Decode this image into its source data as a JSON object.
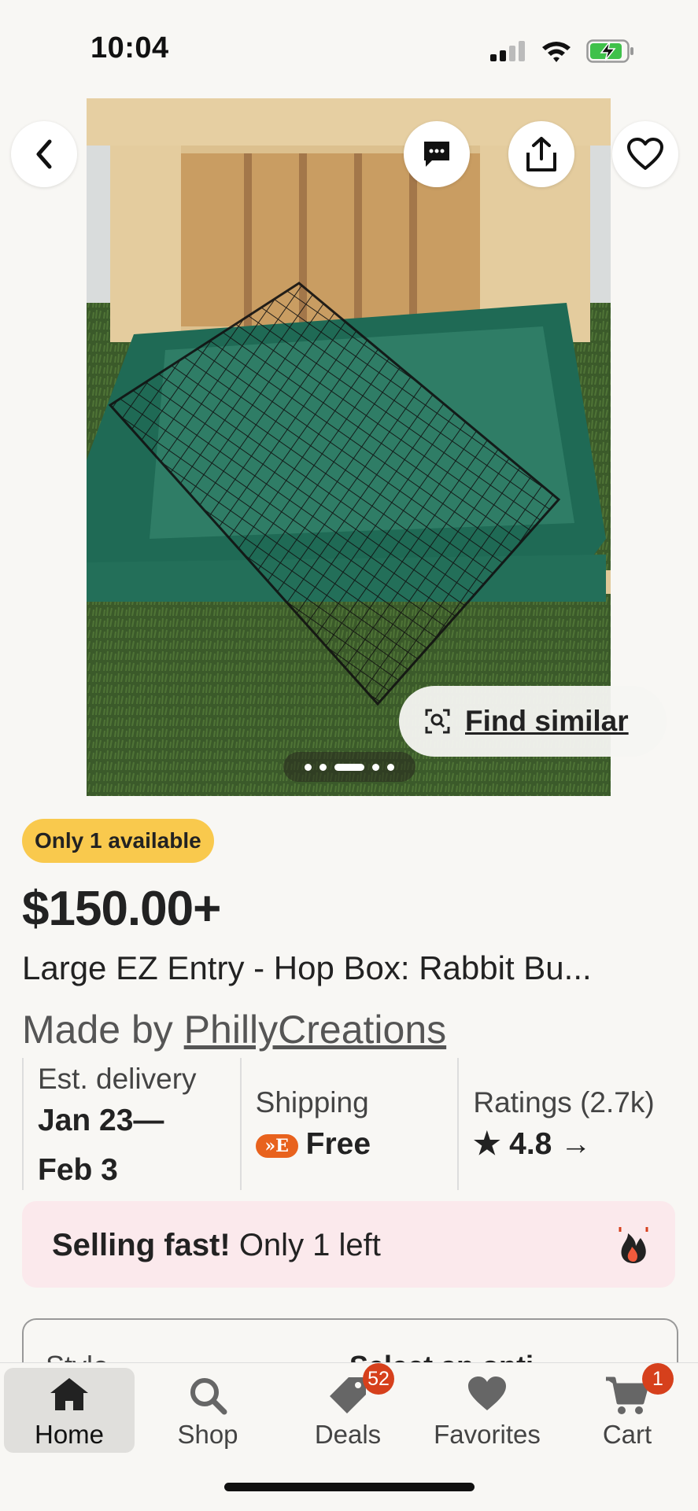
{
  "status_bar": {
    "time": "10:04"
  },
  "hero": {
    "find_similar_label": "Find similar",
    "image_count": 5,
    "active_image": 3
  },
  "listing": {
    "availability_badge": "Only 1 available",
    "price": "$150.00+",
    "title": "Large EZ Entry - Hop Box: Rabbit Bu...",
    "made_by_prefix": "Made by ",
    "shop_name": "PhillyCreations"
  },
  "stats": {
    "delivery_label": "Est. delivery",
    "delivery_line1": "Jan 23—",
    "delivery_line2": "Feb 3",
    "shipping_label": "Shipping",
    "shipping_badge": "»E",
    "shipping_value": "Free",
    "ratings_label": "Ratings (2.7k)",
    "rating_value": "4.8"
  },
  "urgency": {
    "bold": "Selling fast!",
    "rest": " Only 1 left"
  },
  "style_select": {
    "label": "Style",
    "selected": "Select an opti..."
  },
  "tabbar": {
    "home": "Home",
    "shop": "Shop",
    "deals": "Deals",
    "deals_badge": "52",
    "favorites": "Favorites",
    "cart": "Cart",
    "cart_badge": "1"
  },
  "colors": {
    "accent_badge": "#f9c94d",
    "urgency_bg": "#fbe9ec",
    "notification": "#d6401c",
    "etsy_orange": "#e8621d"
  }
}
